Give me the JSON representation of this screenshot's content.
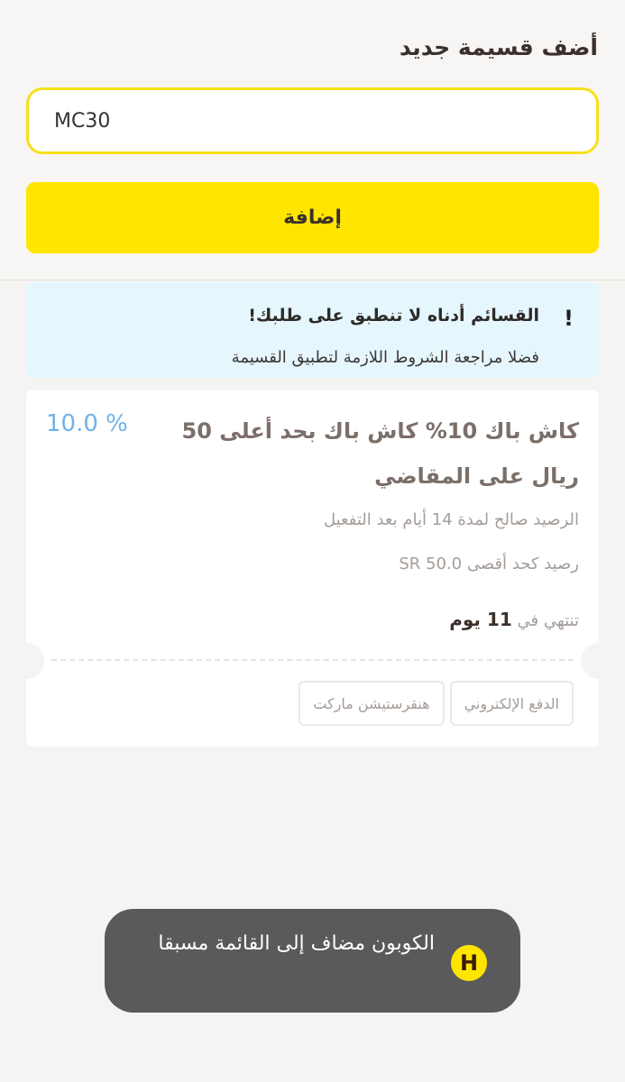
{
  "add_section": {
    "title": "أضف قسيمة جديد",
    "code_value": "MC30",
    "add_label": "إضافة"
  },
  "notice": {
    "icon": "!",
    "title": "القسائم أدناه لا تنطبق على طلبك!",
    "text": "فضلا مراجعة الشروط اللازمة لتطبيق القسيمة"
  },
  "coupon": {
    "title": "كاش باك 10% كاش باك بحد أعلى 50 ريال على المقاضي",
    "percent": "10.0 %",
    "validity": "الرصيد صالح لمدة 14 أيام بعد التفعيل",
    "max_balance": "رصيد كحد أقصى SR 50.0",
    "expiry_prefix": "تنتهي في",
    "expiry_days": "11 يوم",
    "tags": [
      "الدفع الإلكتروني",
      "هنقرستيشن ماركت"
    ]
  },
  "toast": {
    "icon_letter": "H",
    "message": "الكوبون مضاف إلى القائمة مسبقا"
  },
  "colors": {
    "brand_yellow": "#ffe500",
    "percent_blue": "#6fb2e8",
    "notice_bg": "#e6f6fd",
    "toast_bg": "#5a5a5c"
  }
}
